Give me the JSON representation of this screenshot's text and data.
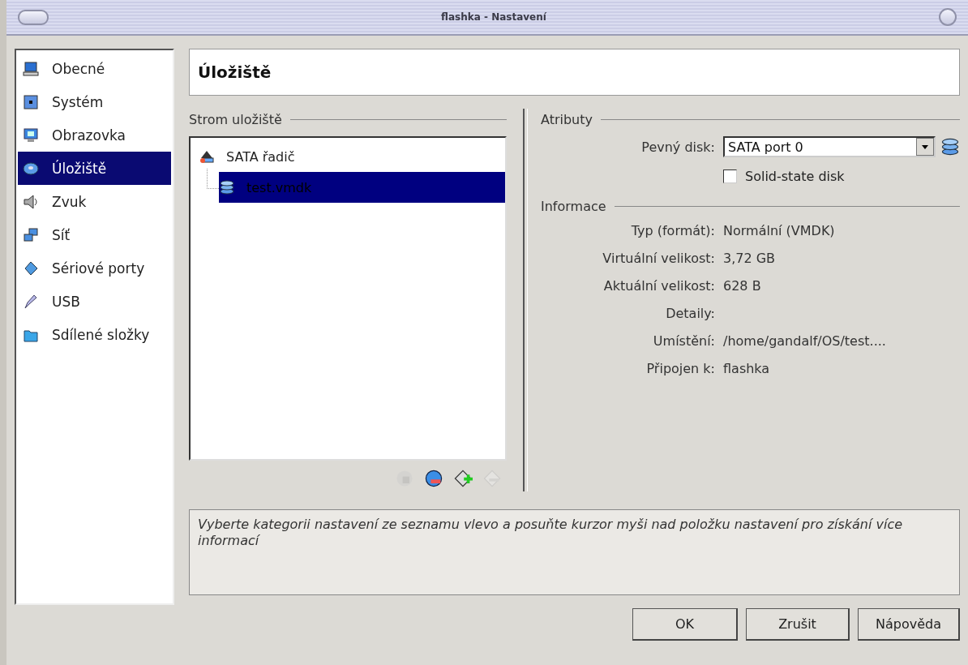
{
  "window": {
    "title": "flashka - Nastavení"
  },
  "sidebar": {
    "items": [
      {
        "label": "Obecné",
        "kind": "general",
        "selected": false
      },
      {
        "label": "Systém",
        "kind": "system",
        "selected": false
      },
      {
        "label": "Obrazovka",
        "kind": "display",
        "selected": false
      },
      {
        "label": "Úložiště",
        "kind": "storage",
        "selected": true
      },
      {
        "label": "Zvuk",
        "kind": "audio",
        "selected": false
      },
      {
        "label": "Síť",
        "kind": "network",
        "selected": false
      },
      {
        "label": "Sériové porty",
        "kind": "serial",
        "selected": false
      },
      {
        "label": "USB",
        "kind": "usb",
        "selected": false
      },
      {
        "label": "Sdílené složky",
        "kind": "folder",
        "selected": false
      }
    ]
  },
  "page_title": "Úložiště",
  "storage_tree": {
    "title": "Strom uložiště",
    "items": [
      {
        "label": "SATA řadič",
        "kind": "controller",
        "selected": false,
        "children": [
          {
            "label": "test.vmdk",
            "kind": "disk",
            "selected": true
          }
        ]
      }
    ],
    "toolbar": [
      {
        "kind": "add-controller",
        "disabled": true
      },
      {
        "kind": "remove-controller",
        "disabled": false
      },
      {
        "kind": "add-disk",
        "disabled": false
      },
      {
        "kind": "remove-disk",
        "disabled": true
      }
    ]
  },
  "attributes": {
    "title": "Atributy",
    "hard_disk_label": "Pevný disk:",
    "hard_disk_value": "SATA port 0",
    "ssd": {
      "label": "Solid-state disk",
      "checked": false
    }
  },
  "information": {
    "title": "Informace",
    "rows": [
      {
        "label": "Typ (formát):",
        "value": "Normální (VMDK)"
      },
      {
        "label": "Virtuální velikost:",
        "value": "3,72 GB"
      },
      {
        "label": "Aktuální velikost:",
        "value": "628 B"
      },
      {
        "label": "Detaily:"
      },
      {
        "label": "Umístění:",
        "value": "/home/gandalf/OS/test...."
      },
      {
        "label": "Připojen k:",
        "value": "flashka"
      }
    ]
  },
  "description": "Vyberte kategorii nastavení ze seznamu vlevo a posuňte kurzor myši nad položku nastavení pro získání více informací",
  "buttons": [
    "OK",
    "Zrušit",
    "Nápověda"
  ]
}
